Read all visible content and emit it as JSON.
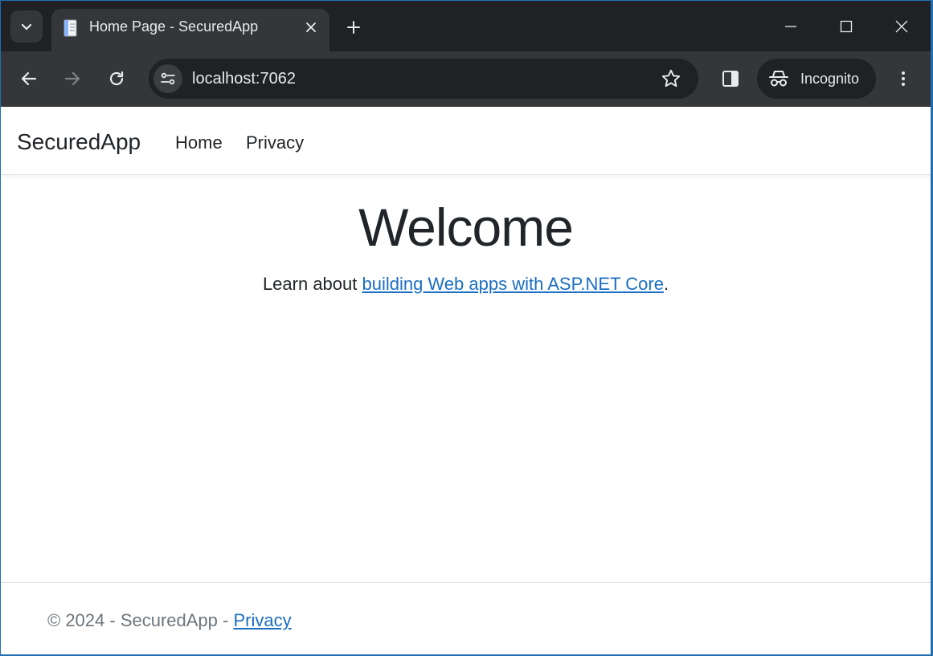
{
  "browser": {
    "tab": {
      "title": "Home Page - SecuredApp",
      "favicon": "document-icon"
    },
    "address": {
      "url": "localhost:7062"
    },
    "profile": {
      "label": "Incognito"
    },
    "colors": {
      "tabstrip": "#202124",
      "toolbar": "#35363a",
      "text": "#e8eaed"
    }
  },
  "site": {
    "brand": "SecuredApp",
    "nav": [
      {
        "label": "Home"
      },
      {
        "label": "Privacy"
      }
    ],
    "main": {
      "heading": "Welcome",
      "intro_prefix": "Learn about ",
      "intro_link": "building Web apps with ASP.NET Core",
      "intro_suffix": "."
    },
    "footer": {
      "copyright": "© 2024 - SecuredApp - ",
      "privacy_link": "Privacy"
    },
    "colors": {
      "link": "#1b6ec2",
      "text": "#212529",
      "muted": "#6c757d"
    }
  }
}
